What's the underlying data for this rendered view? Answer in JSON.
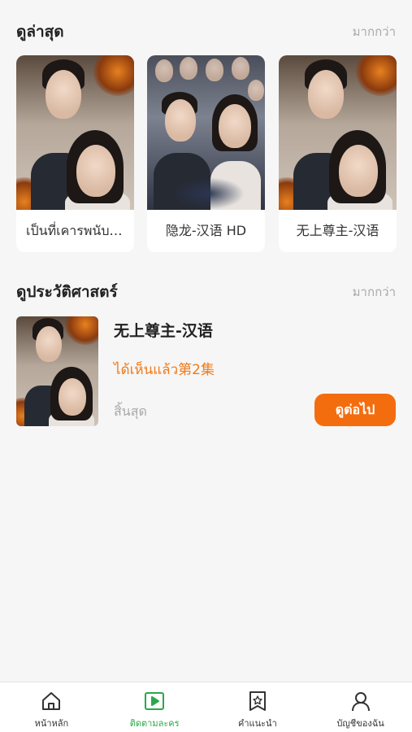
{
  "latest": {
    "title": "ดูล่าสุด",
    "more": "มากกว่า",
    "items": [
      {
        "title": "เป็นที่เคารพนับถือ"
      },
      {
        "title": "隐龙-汉语 HD"
      },
      {
        "title": "无上尊主-汉语"
      }
    ]
  },
  "history": {
    "title": "ดูประวัติศาสตร์",
    "more": "มากกว่า",
    "item": {
      "title": "无上尊主-汉语",
      "progress": "ได้เห็นแล้ว第2集",
      "status": "สิ้นสุด",
      "continue_label": "ดูต่อไป"
    }
  },
  "tabbar": {
    "tabs": [
      {
        "label": "หน้าหลัก",
        "icon": "home-icon"
      },
      {
        "label": "ติดตามละคร",
        "icon": "play-square-icon",
        "active": true
      },
      {
        "label": "คำแนะนำ",
        "icon": "star-bookmark-icon"
      },
      {
        "label": "บัญชีของฉัน",
        "icon": "user-icon"
      }
    ]
  },
  "colors": {
    "accent": "#f36d0f",
    "progress": "#f07a1a",
    "active_tab": "#2aa84a",
    "muted": "#a8a8a8"
  }
}
